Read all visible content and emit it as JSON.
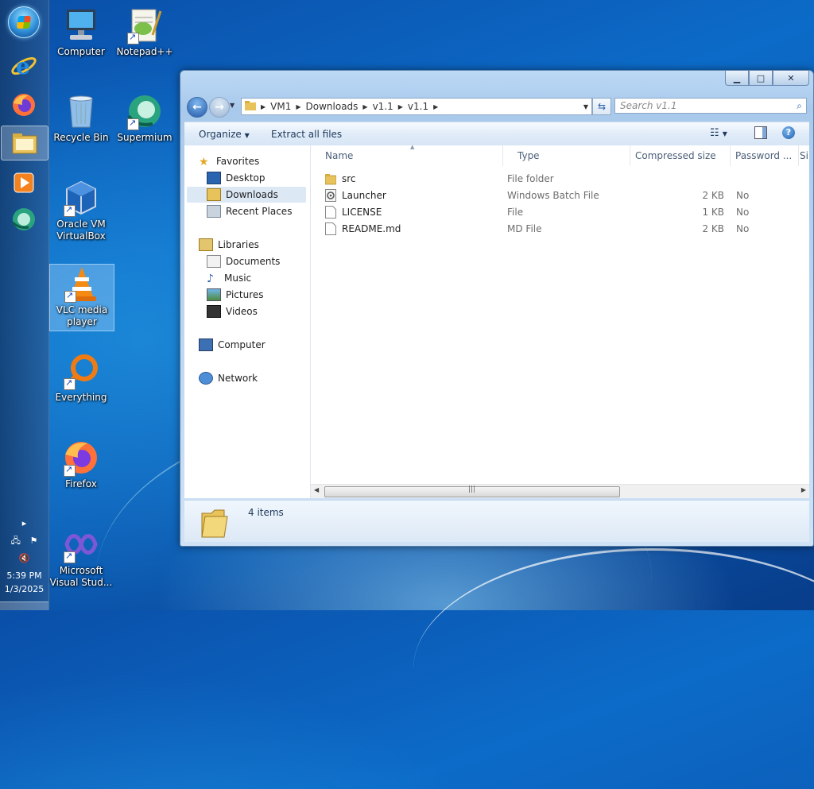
{
  "desktop": {
    "icons": [
      {
        "label": "Computer"
      },
      {
        "label": "Notepad++"
      },
      {
        "label": "Recycle Bin"
      },
      {
        "label": "Supermium"
      },
      {
        "label": "Oracle VM VirtualBox"
      },
      {
        "label": "VLC media player"
      },
      {
        "label": "Everything"
      },
      {
        "label": "Firefox"
      },
      {
        "label": "Microsoft Visual Stud..."
      }
    ]
  },
  "taskbar": {
    "clock_time": "5:39 PM",
    "clock_date": "1/3/2025"
  },
  "explorer": {
    "breadcrumb": [
      "VM1",
      "Downloads",
      "v1.1",
      "v1.1"
    ],
    "search_placeholder": "Search v1.1",
    "toolbar": {
      "organize_label": "Organize",
      "extract_label": "Extract all files"
    },
    "nav": {
      "favorites": "Favorites",
      "desktop": "Desktop",
      "downloads": "Downloads",
      "recent": "Recent Places",
      "libraries": "Libraries",
      "documents": "Documents",
      "music": "Music",
      "pictures": "Pictures",
      "videos": "Videos",
      "computer": "Computer",
      "network": "Network"
    },
    "columns": {
      "name": "Name",
      "type": "Type",
      "compressed_size": "Compressed size",
      "password": "Password ...",
      "size": "Si"
    },
    "files": [
      {
        "name": "src",
        "type": "File folder",
        "size": "",
        "password": ""
      },
      {
        "name": "Launcher",
        "type": "Windows Batch File",
        "size": "2 KB",
        "password": "No"
      },
      {
        "name": "LICENSE",
        "type": "File",
        "size": "1 KB",
        "password": "No"
      },
      {
        "name": "README.md",
        "type": "MD File",
        "size": "2 KB",
        "password": "No"
      }
    ],
    "status_count": "4 items"
  }
}
